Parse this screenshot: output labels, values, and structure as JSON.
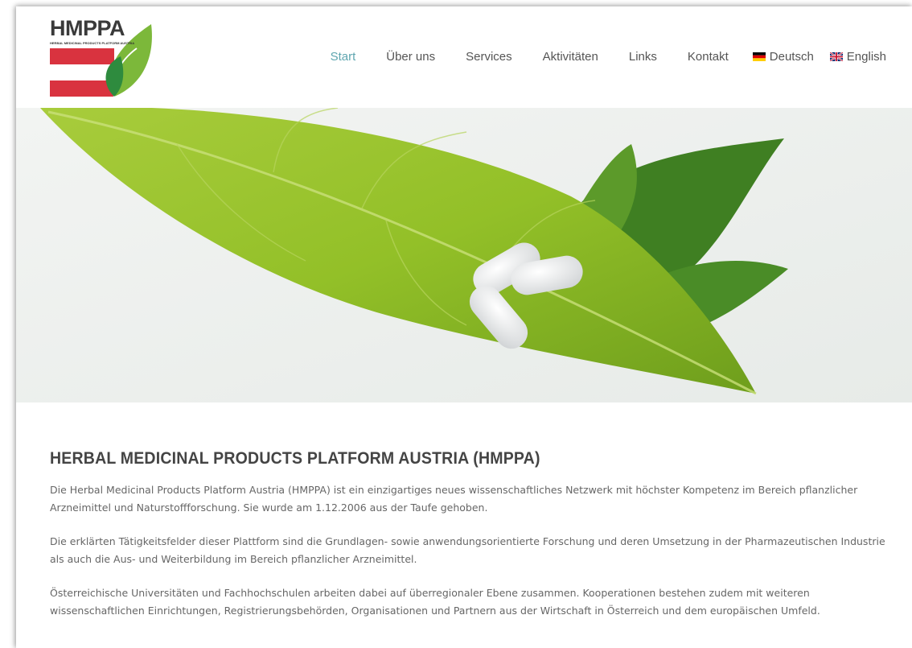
{
  "logo": {
    "name": "HMPPA",
    "tagline": "HERBAL MEDICINAL PRODUCTS PLATFORM AUSTRIA"
  },
  "nav": {
    "items": [
      {
        "label": "Start",
        "active": true
      },
      {
        "label": "Über uns",
        "active": false
      },
      {
        "label": "Services",
        "active": false
      },
      {
        "label": "Aktivitäten",
        "active": false
      },
      {
        "label": "Links",
        "active": false
      },
      {
        "label": "Kontakt",
        "active": false
      }
    ],
    "languages": [
      {
        "label": "Deutsch",
        "flag": "german-flag-icon"
      },
      {
        "label": "English",
        "flag": "uk-flag-icon"
      }
    ]
  },
  "colors": {
    "accent": "#5fa6b0",
    "text": "#555555",
    "leaf": "#8cbf2f",
    "austria_red": "#d9333f"
  },
  "main": {
    "title": "HERBAL MEDICINAL PRODUCTS PLATFORM AUSTRIA (HMPPA)",
    "paragraphs": [
      "Die Herbal Medicinal Products Platform Austria (HMPPA) ist ein einzigartiges neues wissenschaftliches Netzwerk mit höchster Kompetenz im Bereich pflanzlicher Arzneimittel und Naturstoffforschung. Sie wurde am 1.12.2006 aus der Taufe gehoben.",
      "Die erklärten Tätigkeitsfelder dieser Plattform sind die Grundlagen- sowie anwendungsorientierte Forschung und deren Umsetzung in der Pharmazeutischen Industrie als auch die Aus- und Weiterbildung im Bereich pflanzlicher Arzneimittel.",
      "Österreichische Universitäten und Fachhochschulen arbeiten dabei auf überregionaler Ebene zusammen. Kooperationen bestehen zudem mit weiteren wissenschaftlichen Einrichtungen, Registrierungsbehörden, Organisationen und Partnern aus der Wirtschaft in Österreich und dem europäischen Umfeld."
    ]
  }
}
